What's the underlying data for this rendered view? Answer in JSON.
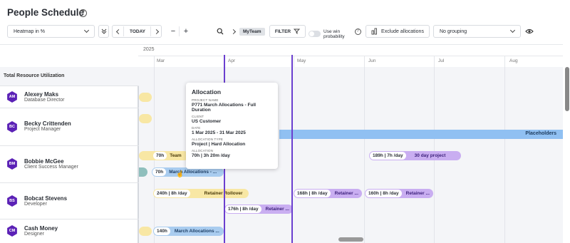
{
  "header": {
    "title": "People Schedule"
  },
  "toolbar": {
    "view_select": "Heatmap in %",
    "today_label": "TODAY",
    "team_chip": "MyTeam",
    "filter_label": "FILTER",
    "use_win_probability": "Use win probability",
    "exclude_allocations": "Exclude allocations",
    "grouping_select": "No grouping"
  },
  "timeline": {
    "year": "2025",
    "months": [
      "Mar",
      "Apr",
      "May",
      "Jun",
      "Jul",
      "Aug"
    ]
  },
  "utilization_label": "Total Resource Utilization",
  "people": [
    {
      "initials": "AM",
      "name": "Alexey Maks",
      "role": "Database Director"
    },
    {
      "initials": "BC",
      "name": "Becky Crittenden",
      "role": "Project Manager"
    },
    {
      "initials": "BM",
      "name": "Bobbie McGee",
      "role": "Client Success Manager"
    },
    {
      "initials": "BS",
      "name": "Bobcat Stevens",
      "role": "Developer"
    },
    {
      "initials": "CM",
      "name": "Cash Money",
      "role": "Designer"
    }
  ],
  "bars": {
    "placeholders": "Placeholders",
    "bm_team": {
      "hours": "70h",
      "label": "Team"
    },
    "bm_march": {
      "hours": "70h",
      "label": "March Allocations - ..."
    },
    "bm_30day": {
      "hours": "189h | 7h /day",
      "label": "30 day project"
    },
    "bs_retainer_rollover": {
      "hours": "240h | 8h /day",
      "label": "Retainer Rollover"
    },
    "bs_retainer_may": {
      "hours": "168h | 8h /day",
      "label": "Retainer ..."
    },
    "bs_retainer_jun": {
      "hours": "160h | 8h /day",
      "label": "Retainer ..."
    },
    "bs_retainer_apr": {
      "hours": "176h | 8h /day",
      "label": "Retainer ..."
    },
    "cm_march": {
      "hours": "140h",
      "label": "March Allocations ..."
    }
  },
  "tooltip": {
    "title": "Allocation",
    "project_name_label": "PROJECT NAME",
    "project_name": "P771 March Allocations - Full Duration",
    "client_label": "CLIENT",
    "client": "US Customer",
    "date_label": "DATE",
    "date": "1 Mar 2025 - 31 Mar 2025",
    "allocation_type_label": "ALLOCATION TYPE",
    "allocation_type": "Project | Hard Allocation",
    "allocation_label": "ALLOCATION",
    "allocation": "70h | 3h 20m /day"
  },
  "colors": {
    "avatar": "#5b21b6",
    "today_marker": "#6b3fcf",
    "bar_yellow": "#f8e7a4",
    "bar_purple": "#c9aef1",
    "bar_blue": "#a9ccef",
    "placeholder_blue": "#90c0f2"
  },
  "icons": [
    "help-icon",
    "chevron-down-icon",
    "collapse-icon",
    "chevron-left-icon",
    "chevron-right-icon",
    "minus-icon",
    "plus-icon",
    "search-icon",
    "filter-icon",
    "bar-chart-icon",
    "eye-icon"
  ]
}
